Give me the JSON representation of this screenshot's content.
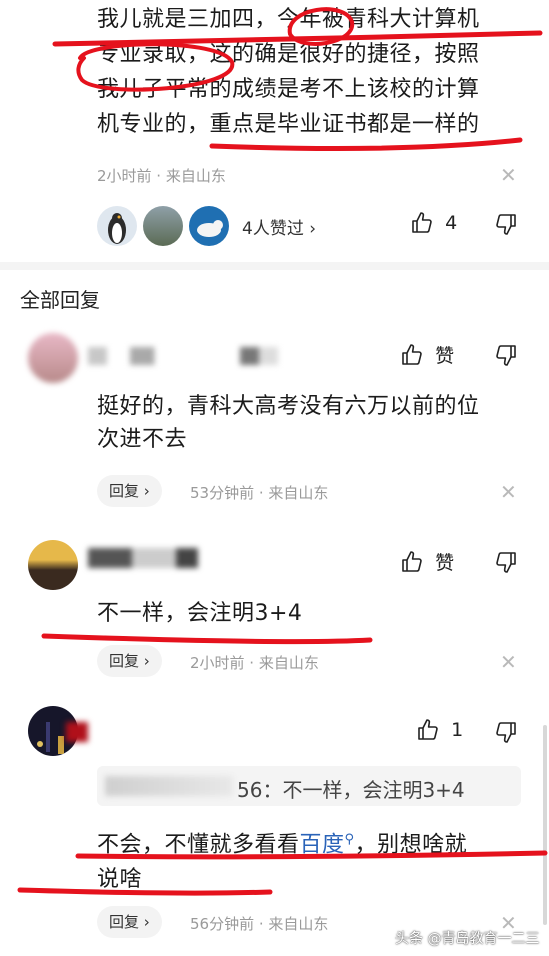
{
  "top_comment": {
    "text_lines": [
      "我儿就是三加四，今年被青科大计算机",
      "专业录取，这的确是很好的捷径，按照",
      "我儿子平常的成绩是考不上该校的计算",
      "机专业的，重点是毕业证书都是一样的"
    ],
    "meta": "2小时前 · 来自山东",
    "likers_text": "4人赞过 ›",
    "like_count": "4"
  },
  "section_title": "全部回复",
  "replies": [
    {
      "text_lines": [
        "挺好的，青科大高考没有六万以前的位",
        "次进不去"
      ],
      "like_label": "赞",
      "reply_label": "回复 ›",
      "meta": "53分钟前 · 来自山东"
    },
    {
      "text_lines": [
        "不一样，会注明3+4"
      ],
      "like_label": "赞",
      "reply_label": "回复 ›",
      "meta": "2小时前 · 来自山东"
    },
    {
      "quote": "56：不一样，会注明3+4",
      "text_prefix": "不会，不懂就多看看",
      "link": "百度",
      "text_suffix": "，别想啥就",
      "text_line2": "说啥",
      "like_count": "1",
      "reply_label": "回复 ›",
      "meta": "56分钟前 · 来自山东"
    }
  ],
  "watermark": "头条 @青岛教育一二三",
  "colors": {
    "annotation_red": "#e5121d",
    "link_blue": "#2a63b8"
  }
}
